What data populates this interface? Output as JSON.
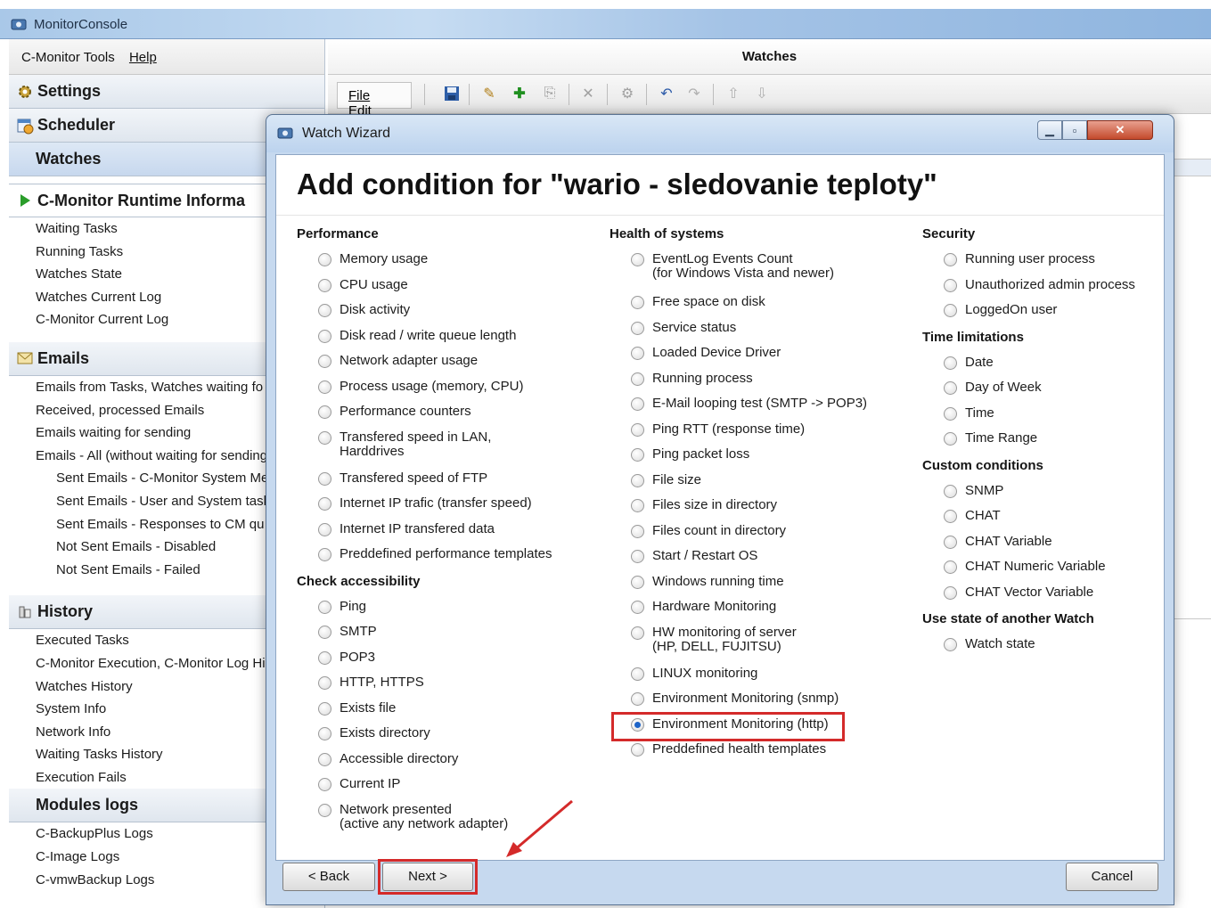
{
  "window": {
    "title": "MonitorConsole"
  },
  "left_menu": [
    "C-Monitor Tools",
    "Help"
  ],
  "left_panel": {
    "settings": "Settings",
    "scheduler": "Scheduler",
    "watches": "Watches",
    "runtime": {
      "header": "C-Monitor Runtime Informa",
      "items": [
        "Waiting Tasks",
        "Running Tasks",
        "Watches State",
        "Watches Current Log",
        "C-Monitor Current Log"
      ]
    },
    "emails": {
      "header": "Emails",
      "items": [
        "Emails from Tasks, Watches waiting fo",
        "Received, processed Emails",
        "Emails waiting for sending",
        "Emails - All (without waiting for sending"
      ],
      "sub_items": [
        "Sent Emails - C-Monitor System Me",
        "Sent Emails - User and System task",
        "Sent Emails - Responses to CM qu",
        "Not Sent Emails - Disabled",
        "Not Sent Emails - Failed"
      ]
    },
    "history": {
      "header": "History",
      "items": [
        "Executed Tasks",
        "C-Monitor Execution, C-Monitor Log Hi",
        "Watches History",
        "System Info",
        "Network Info",
        "Waiting Tasks History",
        "Execution Fails"
      ]
    },
    "modules": {
      "header": "Modules logs",
      "items": [
        "C-BackupPlus Logs",
        "C-Image Logs",
        "C-vmwBackup Logs"
      ]
    }
  },
  "watches_header": "Watches",
  "toolbar": {
    "file": "File",
    "edit": "Edit"
  },
  "dialog": {
    "title": "Watch Wizard",
    "heading": "Add condition for \"wario - sledovanie teploty\"",
    "performance": {
      "title": "Performance",
      "options": [
        "Memory usage",
        "CPU usage",
        "Disk activity",
        "Disk read / write queue length",
        "Network adapter usage",
        "Process usage (memory, CPU)",
        "Performance counters"
      ],
      "two_line": [
        "Transfered speed in LAN,",
        "Harddrives"
      ],
      "options_after": [
        "Transfered speed of FTP",
        "Internet IP trafic (transfer speed)",
        "Internet IP transfered data",
        "Preddefined performance templates"
      ]
    },
    "accessibility": {
      "title": "Check accessibility",
      "options": [
        "Ping",
        "SMTP",
        "POP3",
        "HTTP, HTTPS",
        "Exists file",
        "Exists directory",
        "Accessible directory",
        "Current IP"
      ],
      "two_line": [
        "Network presented",
        "(active any network adapter)"
      ]
    },
    "health": {
      "title": "Health of systems",
      "first": [
        "EventLog Events Count",
        "(for Windows Vista and newer)"
      ],
      "options": [
        "Free space on disk",
        "Service status",
        "Loaded Device Driver",
        "Running process",
        "E-Mail looping test (SMTP -> POP3)",
        "Ping RTT (response time)",
        "Ping packet loss",
        "File size",
        "Files size in directory",
        "Files count in directory",
        "Start / Restart OS",
        "Windows running time",
        "Hardware Monitoring"
      ],
      "hw": [
        "HW monitoring of server",
        "(HP, DELL, FUJITSU)"
      ],
      "options_after": [
        "LINUX monitoring",
        "Environment Monitoring (snmp)"
      ],
      "selected": "Environment Monitoring (http)",
      "last": "Preddefined health templates"
    },
    "security": {
      "title": "Security",
      "options": [
        "Running user process",
        "Unauthorized admin process",
        "LoggedOn user"
      ]
    },
    "time": {
      "title": "Time limitations",
      "options": [
        "Date",
        "Day of Week",
        "Time",
        "Time Range"
      ]
    },
    "custom": {
      "title": "Custom conditions",
      "options": [
        "SNMP",
        "CHAT",
        "CHAT Variable",
        "CHAT Numeric Variable",
        "CHAT Vector Variable"
      ]
    },
    "another": {
      "title": "Use state of another Watch",
      "options": [
        "Watch state"
      ]
    },
    "buttons": {
      "back": "< Back",
      "next": "Next >",
      "cancel": "Cancel"
    }
  },
  "colors": {
    "highlight": "#d42a2a",
    "radio_selected": "#1d64c8",
    "title_bar": "#a9c8e8"
  }
}
